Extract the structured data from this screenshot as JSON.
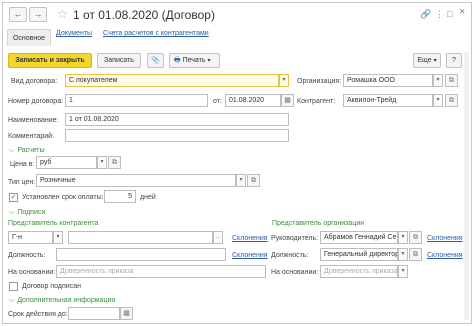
{
  "header": {
    "title": "1 от 01.08.2020 (Договор)",
    "back_glyph": "←",
    "forward_glyph": "→",
    "star_glyph": "☆",
    "link_glyph": "🔗",
    "menu_glyph": "⋮",
    "maximize_glyph": "□",
    "close_glyph": "×"
  },
  "tabs": [
    {
      "label": "Основное"
    },
    {
      "label": "Документы"
    },
    {
      "label": "Счета расчетов с контрагентами"
    }
  ],
  "toolbar": {
    "save_close_label": "Записать и закрыть",
    "save_label": "Записать",
    "attach_icon": "📎",
    "print_label": "Печать",
    "print_icon": "🖶",
    "more_label": "Еще",
    "help_label": "?"
  },
  "form": {
    "contract_type_label": "Вид договора:",
    "contract_type_value": "С покупателем",
    "organization_label": "Организация:",
    "organization_value": "Ромашка ООО",
    "contract_number_label": "Номер договора:",
    "contract_number_value": "1",
    "date_label": "от:",
    "date_value": "01.08.2020",
    "counterparty_label": "Контрагент:",
    "counterparty_value": "Аквилон-Трейд",
    "name_label": "Наименование:",
    "name_value": "1 от 01.08.2020",
    "comment_label": "Комментарий:",
    "comment_value": ""
  },
  "settlements": {
    "section_title": "Расчеты",
    "price_in_label": "Цена в:",
    "price_in_value": "руб",
    "price_type_label": "Тип цен:",
    "price_type_value": "Розничные",
    "payment_term_label": "Установлен срок оплаты:",
    "payment_term_checked": true,
    "payment_term_days": "5",
    "days_label": "дней"
  },
  "signatures": {
    "section_title": "Подписи",
    "counterparty_rep_title": "Представитель контрагента",
    "org_rep_title": "Представитель организации",
    "salutation_value": "Г-н",
    "full_name_value": "",
    "declension_link": "Склонения",
    "position_label": "Должность:",
    "position_value": "",
    "basis_label": "На основании:",
    "basis_placeholder": "Доверенность приказа",
    "head_label": "Руководитель:",
    "head_value": "Абрамов Геннадий Сер",
    "org_position_value": "Генеральный директор",
    "org_basis_placeholder": "Доверенность приказа",
    "signed_label": "Договор подписан",
    "signed_checked": false
  },
  "additional": {
    "section_title": "Дополнительная информация",
    "validity_label": "Срок действия до:"
  }
}
